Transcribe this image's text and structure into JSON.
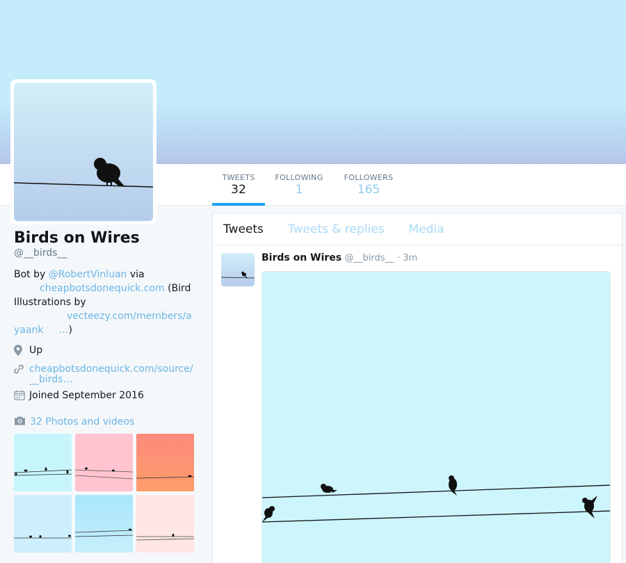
{
  "colors": {
    "accent": "#1da1f2",
    "link": "#6ab5e6",
    "banner": "#c4ecfa"
  },
  "nav": {
    "stats": [
      {
        "label": "TWEETS",
        "value": "32"
      },
      {
        "label": "FOLLOWING",
        "value": "1"
      },
      {
        "label": "FOLLOWERS",
        "value": "165"
      }
    ]
  },
  "profile": {
    "name": "Birds on Wires",
    "handle": "@__birds__",
    "bio": {
      "p1": "Bot by ",
      "link1": "@RobertVinluan",
      "p2": " via",
      "link2": "cheapbotsdonequick.com",
      "p3": " (Bird Illustrations by",
      "link3a": "vecteezy.com/members/a",
      "link3b": "yaank",
      "link3c": "…",
      "p4": ")"
    },
    "location": "Up",
    "website_line1": "cheapbotsdonequick.com/source/",
    "website_line2": "__birds…",
    "joined": "Joined September 2016",
    "location_icon": "map-pin-icon",
    "link_icon": "link-icon",
    "calendar_icon": "calendar-icon"
  },
  "photos": {
    "title": "32 Photos and videos",
    "icon": "camera-icon",
    "thumbs": [
      {
        "bg": "#c6f6fb"
      },
      {
        "bg": "#ffc4cf"
      },
      {
        "bg": "#fc8f7a"
      },
      {
        "bg": "#cdeefc"
      },
      {
        "bg": "#a9e4fb"
      },
      {
        "bg": "#fee6e4"
      }
    ]
  },
  "timeline": {
    "tabs": [
      "Tweets",
      "Tweets & replies",
      "Media"
    ],
    "tweet": {
      "name": "Birds on Wires",
      "handle": "@__birds__",
      "time": "· 3m"
    }
  }
}
